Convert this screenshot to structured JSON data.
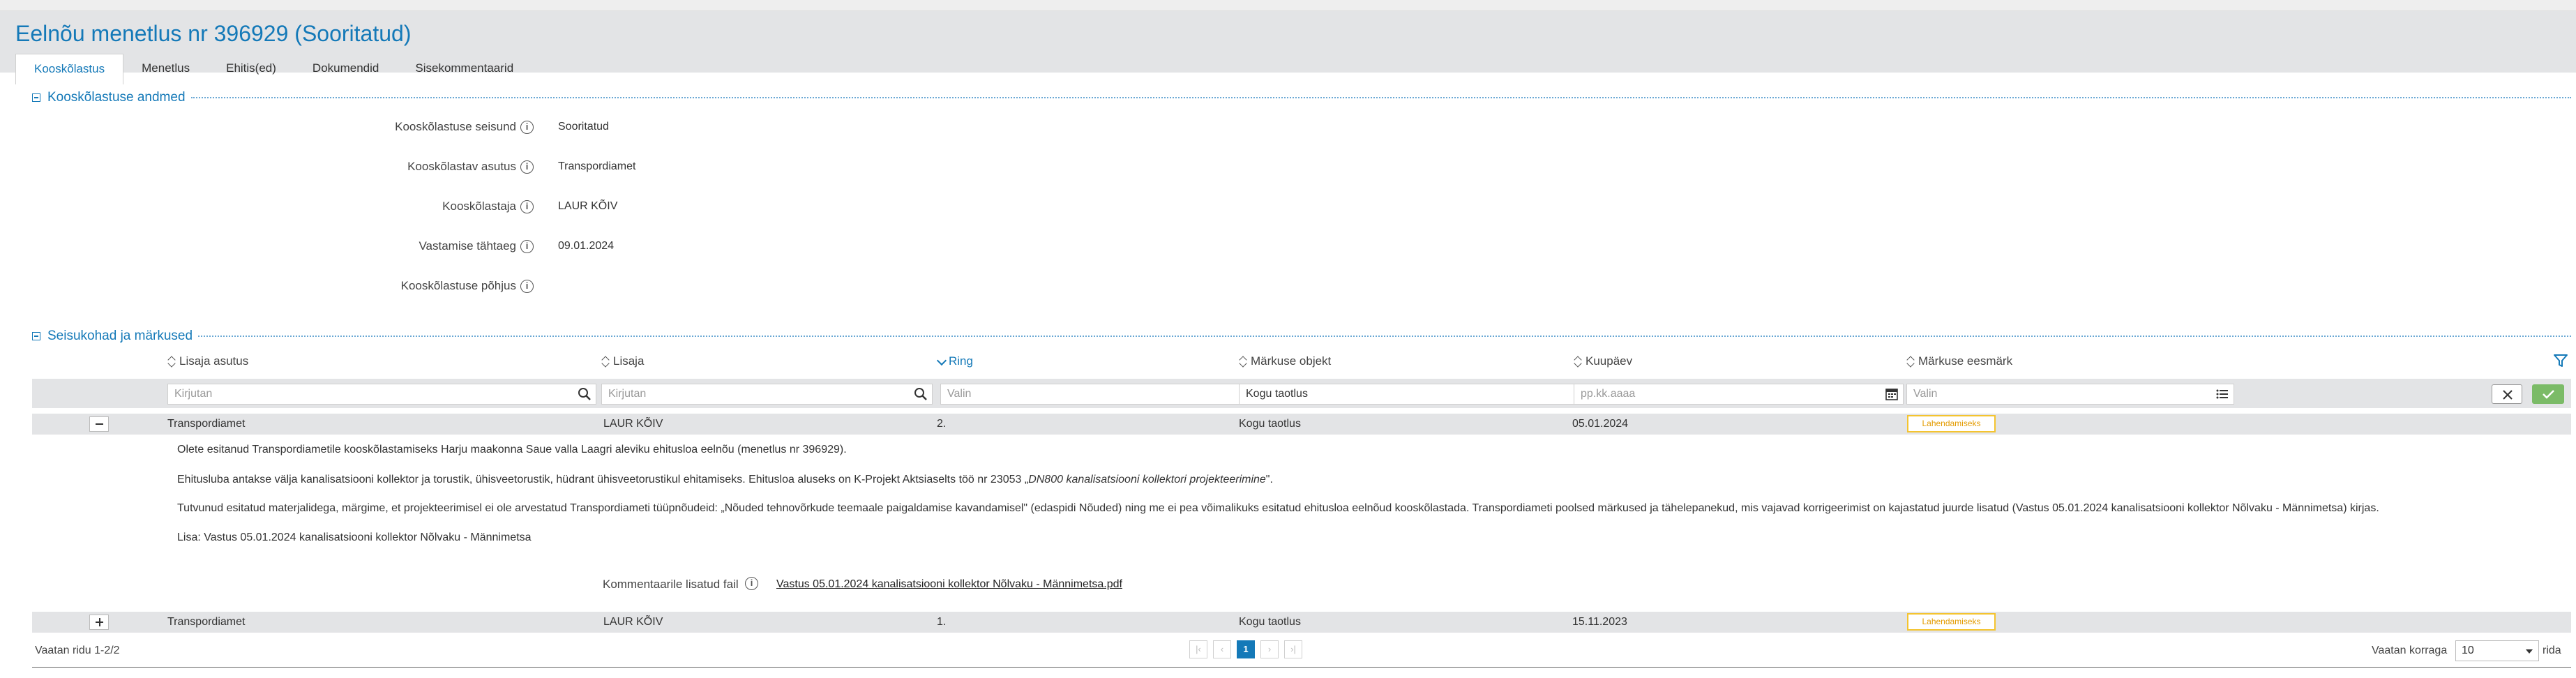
{
  "page": {
    "title": "Eelnõu menetlus nr 396929 (Sooritatud)"
  },
  "tabs": [
    {
      "label": "Kooskõlastus"
    },
    {
      "label": "Menetlus"
    },
    {
      "label": "Ehitis(ed)"
    },
    {
      "label": "Dokumendid"
    },
    {
      "label": "Sisekommentaarid"
    }
  ],
  "details": {
    "section_title": "Kooskõlastuse andmed",
    "fields": [
      {
        "label": "Kooskõlastuse seisund",
        "value": "Sooritatud"
      },
      {
        "label": "Kooskõlastav asutus",
        "value": "Transpordiamet"
      },
      {
        "label": "Kooskõlastaja",
        "value": "LAUR KÕIV"
      },
      {
        "label": "Vastamise tähtaeg",
        "value": "09.01.2024"
      },
      {
        "label": "Kooskõlastuse põhjus",
        "value": ""
      }
    ]
  },
  "remarks": {
    "section_title": "Seisukohad ja märkused",
    "columns": [
      "Lisaja asutus",
      "Lisaja",
      "Ring",
      "Märkuse objekt",
      "Kuupäev",
      "Märkuse eesmärk"
    ],
    "filters": [
      "Kirjutan",
      "Kirjutan",
      "Valin",
      "Kogu taotlus",
      "pp.kk.aaaa",
      "Valin"
    ],
    "rows": [
      {
        "org": "Transpordiamet",
        "author": "LAUR KÕIV",
        "round": "2.",
        "object": "Kogu taotlus",
        "date": "05.01.2024",
        "purpose": "Lahendamiseks"
      },
      {
        "org": "Transpordiamet",
        "author": "LAUR KÕIV",
        "round": "1.",
        "object": "Kogu taotlus",
        "date": "15.11.2023",
        "purpose": "Lahendamiseks"
      }
    ],
    "expanded": {
      "p1": "Olete esitanud Transpordiametile kooskõlastamiseks Harju maakonna Saue valla Laagri aleviku ehitusloa eelnõu (menetlus nr 396929).",
      "p2_pre": "Ehitusluba antakse välja kanalisatsiooni kollektor ja torustik, ühisveetorustik, hüdrant ühisveetorustikul ehitamiseks. Ehitusloa aluseks on K-Projekt Aktsiaselts töö nr 23053 „",
      "p2_italic": "DN800 kanalisatsiooni kollektori projekteerimine",
      "p2_post": "\".",
      "p3": "Tutvunud esitatud materjalidega, märgime, et projekteerimisel ei ole arvestatud Transpordiameti tüüpnõudeid: „Nõuded tehnovõrkude teemaale paigaldamise kavandamisel\" (edaspidi Nõuded) ning me ei pea võimalikuks esitatud ehitusloa eelnõud kooskõlastada. Transpordiameti poolsed märkused ja tähelepanekud, mis vajavad korrigeerimist on kajastatud juurde lisatud (Vastus 05.01.2024 kanalisatsiooni kollektor Nõlvaku - Männimetsa) kirjas.",
      "p4": "Lisa: Vastus 05.01.2024 kanalisatsiooni kollektor Nõlvaku - Männimetsa",
      "file_label": "Kommentaarile lisatud fail",
      "file_name": "Vastus 05.01.2024 kanalisatsiooni kollektor Nõlvaku - Männimetsa.pdf"
    }
  },
  "footer": {
    "count": "Vaatan ridu 1-2/2",
    "current_page": "1",
    "per_page_label": "Vaatan korraga",
    "per_page_value": "10",
    "rows_suffix": "rida"
  },
  "colors": {
    "accent": "#1479b8",
    "badge": "#f4c430",
    "ok": "#7bbb67"
  }
}
